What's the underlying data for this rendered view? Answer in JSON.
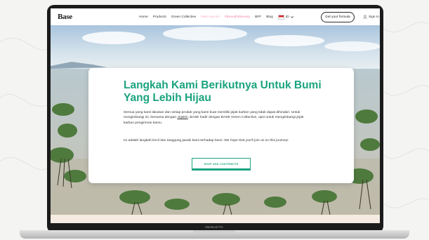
{
  "nav": {
    "logo": "Base",
    "links": [
      "Home",
      "Products",
      "Green Collective",
      "New Launch",
      "#BeautifulBeauty",
      "BFF",
      "Blog"
    ],
    "language": "ID",
    "formula_button": "Get your formula",
    "sign_in": "Sign In"
  },
  "hero": {
    "headline": "Langkah Kami Berikutnya Untuk Bumi Yang Lebih Hijau",
    "paragraph1_before": "Semua yang kami lakukan dan setiap produk yang kami buat memiliki jejak karbon yang tidak dapat dihindari. Untuk mengimbangi ini, bersama dengan ",
    "paragraph1_link": "Jejakin",
    "paragraph1_after": ", BASE hadir dengan BASE Green Collective, opsi untuk mengimbangi jejak karbon pengiriman kamu.",
    "paragraph2": "Ini adalah langkah kecil dan tanggung jawab kami terhadap bumi. We hope that you'll join us on this journey!",
    "cta": "SHOP AND CONTRIBUTE"
  },
  "device_label": "MacBook Pro",
  "colors": {
    "accent": "#1aa37f",
    "nav_highlight": "#f08bb2",
    "laptop_frame": "#1b1b1c"
  }
}
